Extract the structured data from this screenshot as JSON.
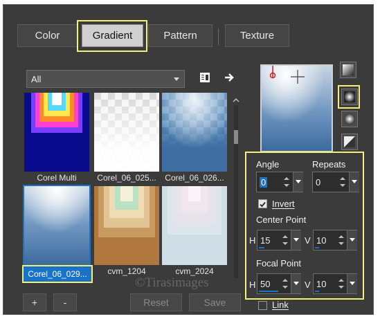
{
  "tabs": [
    {
      "label": "Color"
    },
    {
      "label": "Gradient"
    },
    {
      "label": "Pattern"
    },
    {
      "label": "Texture"
    }
  ],
  "category": {
    "selected": "All"
  },
  "gradients": [
    {
      "label": "Corel Multi"
    },
    {
      "label": "Corel_06_025..."
    },
    {
      "label": "Corel_06_026..."
    },
    {
      "label": "Corel_06_029..."
    },
    {
      "label": "cvm_1204"
    },
    {
      "label": "cvm_2024"
    }
  ],
  "selected_gradient_index": 3,
  "settings": {
    "angle_label": "Angle",
    "angle_value": "0",
    "repeats_label": "Repeats",
    "repeats_value": "0",
    "invert_label": "Invert",
    "invert_checked": true,
    "center_label": "Center Point",
    "center_h_label": "H",
    "center_h_value": "15",
    "center_v_label": "V",
    "center_v_value": "10",
    "focal_label": "Focal Point",
    "focal_h_label": "H",
    "focal_h_value": "50",
    "focal_v_label": "V",
    "focal_v_value": "10",
    "link_label": "Link",
    "link_checked": false
  },
  "buttons": {
    "add": "+",
    "remove": "-",
    "reset": "Reset",
    "save": "Save"
  },
  "watermark": "©Tirasimages",
  "colors": {
    "highlight": "#f2f277",
    "selected_blue": "#1a73c9",
    "panel_bg": "#3b3b3b"
  }
}
